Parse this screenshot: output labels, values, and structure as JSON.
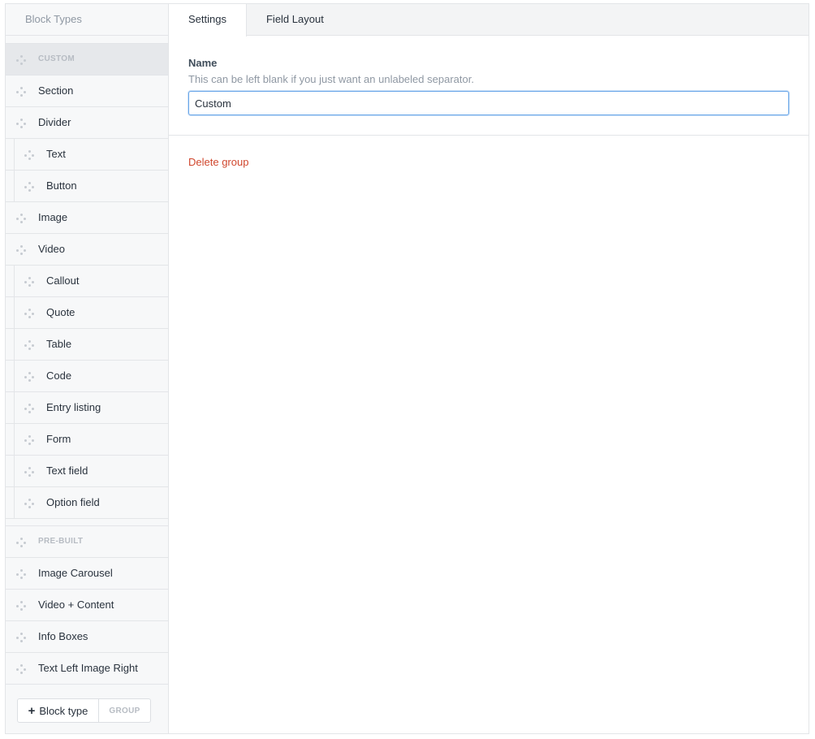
{
  "sidebar": {
    "header": "Block Types",
    "groups": [
      {
        "heading": "CUSTOM",
        "items": [
          {
            "label": "Section"
          },
          {
            "label": "Divider"
          },
          {
            "label": "Text"
          },
          {
            "label": "Button"
          },
          {
            "label": "Image"
          },
          {
            "label": "Video"
          },
          {
            "label": "Callout"
          },
          {
            "label": "Quote"
          },
          {
            "label": "Table"
          },
          {
            "label": "Code"
          },
          {
            "label": "Entry listing"
          },
          {
            "label": "Form"
          },
          {
            "label": "Text field"
          },
          {
            "label": "Option field"
          }
        ]
      },
      {
        "heading": "PRE-BUILT",
        "items": [
          {
            "label": "Image Carousel"
          },
          {
            "label": "Video + Content"
          },
          {
            "label": "Info Boxes"
          },
          {
            "label": "Text Left Image Right"
          }
        ]
      }
    ],
    "add_block_type_label": "Block type",
    "group_label": "GROUP"
  },
  "tabs": [
    {
      "label": "Settings",
      "active": true
    },
    {
      "label": "Field Layout",
      "active": false
    }
  ],
  "settings": {
    "name_label": "Name",
    "name_instructions": "This can be left blank if you just want an unlabeled separator.",
    "name_value": "Custom",
    "delete_label": "Delete group"
  },
  "colors": {
    "accent_focus": "#69a6e8",
    "danger": "#d0472e",
    "sidebar_bg": "#f7f8f9",
    "selected_bg": "#e6e8eb"
  }
}
